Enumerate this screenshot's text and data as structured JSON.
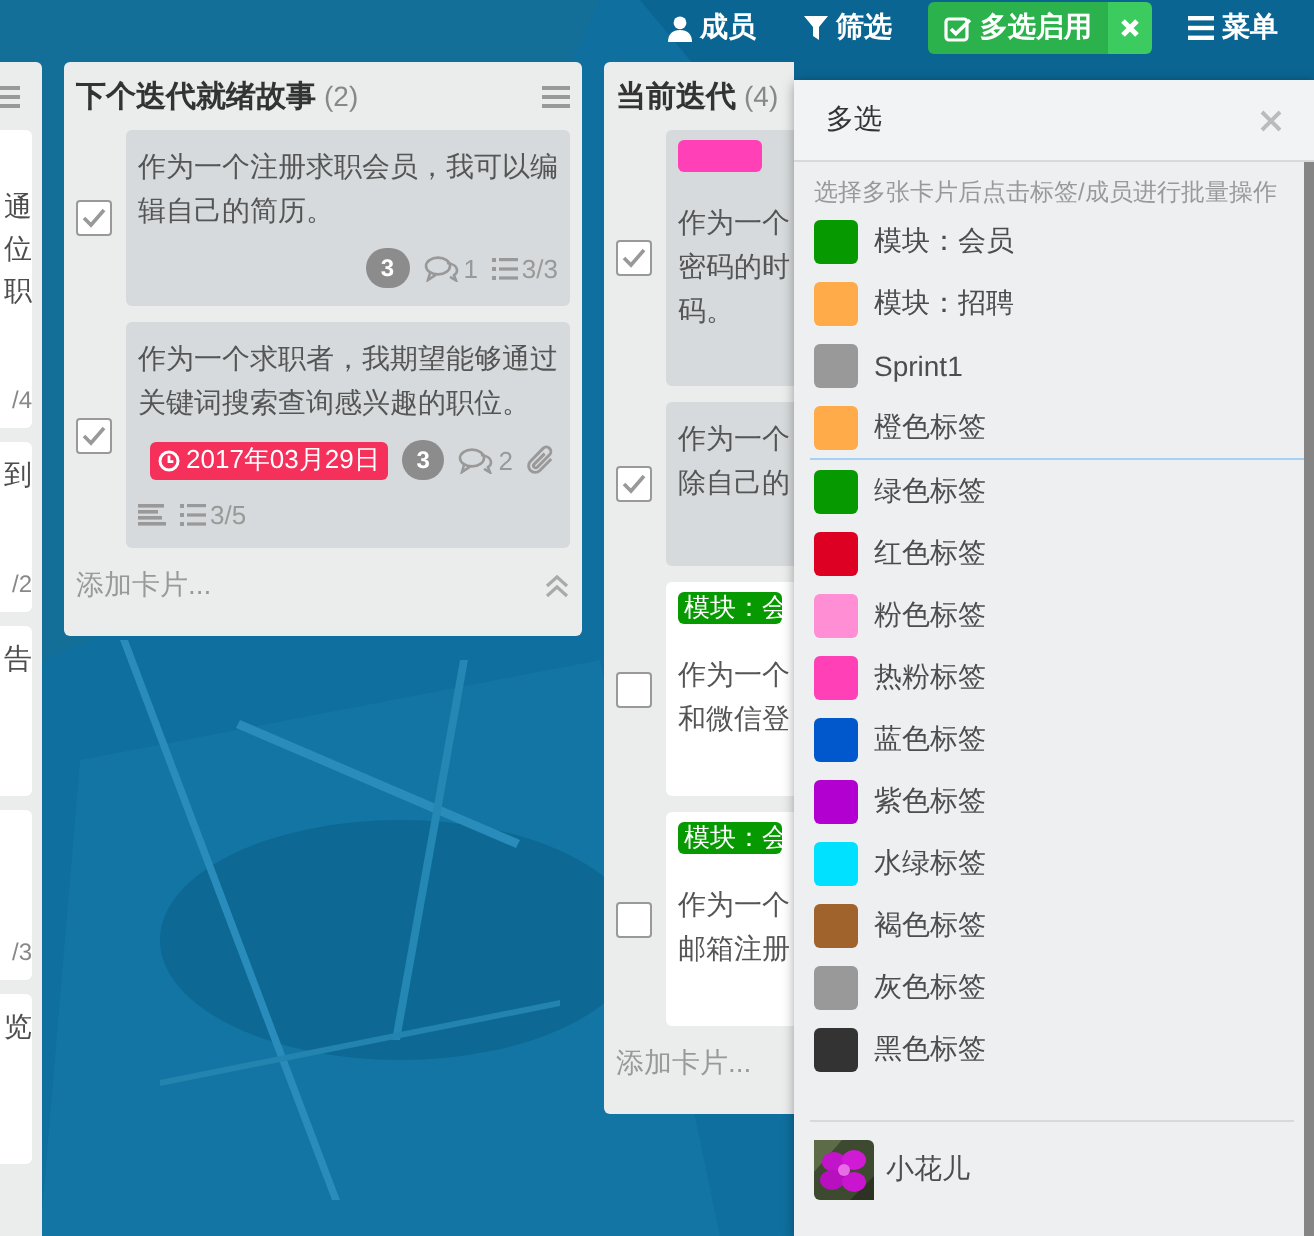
{
  "top_bar": {
    "buttons": [
      {
        "kind": "members",
        "label": "成员"
      },
      {
        "kind": "filter",
        "label": "筛选"
      },
      {
        "kind": "multiselect",
        "label": "多选启用",
        "on": true
      },
      {
        "kind": "menu",
        "label": "菜单"
      }
    ]
  },
  "lists": [
    {
      "kind": "clipped",
      "cards": [
        {
          "lines": [
            "通",
            "位",
            "职"
          ],
          "meta": "/4"
        },
        {
          "lines": [
            "到"
          ],
          "meta": "/2"
        },
        {
          "lines": [
            "告"
          ]
        },
        {
          "meta": "/3"
        },
        {
          "lines": [
            "览"
          ]
        }
      ]
    },
    {
      "kind": "full",
      "title": "下个迭代就绪故事",
      "count": "(2)",
      "add_card": "添加卡片...",
      "cards": [
        {
          "checked": true,
          "lines": [
            "作为一个注册求职会员，我可以编",
            "辑自己的简历。"
          ],
          "badge_rows": [
            [
              {
                "kind": "points",
                "text": "3"
              },
              {
                "kind": "comments",
                "text": "1"
              },
              {
                "kind": "checklist",
                "text": "3/3"
              }
            ]
          ]
        },
        {
          "checked": true,
          "lines": [
            "作为一个求职者，我期望能够通过",
            "关键词搜索查询感兴趣的职位。"
          ],
          "badge_rows": [
            [
              {
                "kind": "due",
                "text": "2017年03月29日"
              },
              {
                "kind": "points",
                "text": "3"
              },
              {
                "kind": "comments",
                "text": "2"
              },
              {
                "kind": "attachment"
              }
            ],
            [
              {
                "kind": "description"
              },
              {
                "kind": "checklist",
                "text": "3/5"
              }
            ]
          ]
        }
      ]
    },
    {
      "kind": "covered",
      "title": "当前迭代",
      "count": "(4)",
      "add_card": "添加卡片...",
      "cards": [
        {
          "checked": true,
          "labels": [
            {
              "color": "#ff40b6"
            }
          ],
          "lines": [
            "作为一个",
            "密码的时",
            "码。"
          ]
        },
        {
          "checked": true,
          "lines": [
            "作为一个",
            "除自己的"
          ]
        },
        {
          "checked": false,
          "labels": [
            {
              "text": "模块：会",
              "color": "#079a00"
            }
          ],
          "lines": [
            "作为一个",
            "和微信登"
          ]
        },
        {
          "checked": false,
          "labels": [
            {
              "text": "模块：会",
              "color": "#079a00"
            }
          ],
          "lines": [
            "作为一个",
            "邮箱注册"
          ]
        }
      ]
    }
  ],
  "popover": {
    "title": "多选",
    "hint": "选择多张卡片后点击标签/成员进行批量操作",
    "label_groups": [
      [
        {
          "name": "模块：会员",
          "color": "#079a00"
        },
        {
          "name": "模块：招聘",
          "color": "#ffab4a"
        },
        {
          "name": "Sprint1",
          "color": "#999999"
        },
        {
          "name": "橙色标签",
          "color": "#ffab4a"
        }
      ],
      [
        {
          "name": "绿色标签",
          "color": "#079a00"
        },
        {
          "name": "红色标签",
          "color": "#de0022"
        },
        {
          "name": "粉色标签",
          "color": "#ff8ed4"
        },
        {
          "name": "热粉标签",
          "color": "#ff40b6"
        },
        {
          "name": "蓝色标签",
          "color": "#0058cc"
        },
        {
          "name": "紫色标签",
          "color": "#b100d0"
        },
        {
          "name": "水绿标签",
          "color": "#00e0ff"
        },
        {
          "name": "褐色标签",
          "color": "#a1632c"
        },
        {
          "name": "灰色标签",
          "color": "#999999"
        },
        {
          "name": "黑色标签",
          "color": "#333333"
        }
      ]
    ],
    "members": [
      {
        "name": "小花儿"
      }
    ]
  }
}
